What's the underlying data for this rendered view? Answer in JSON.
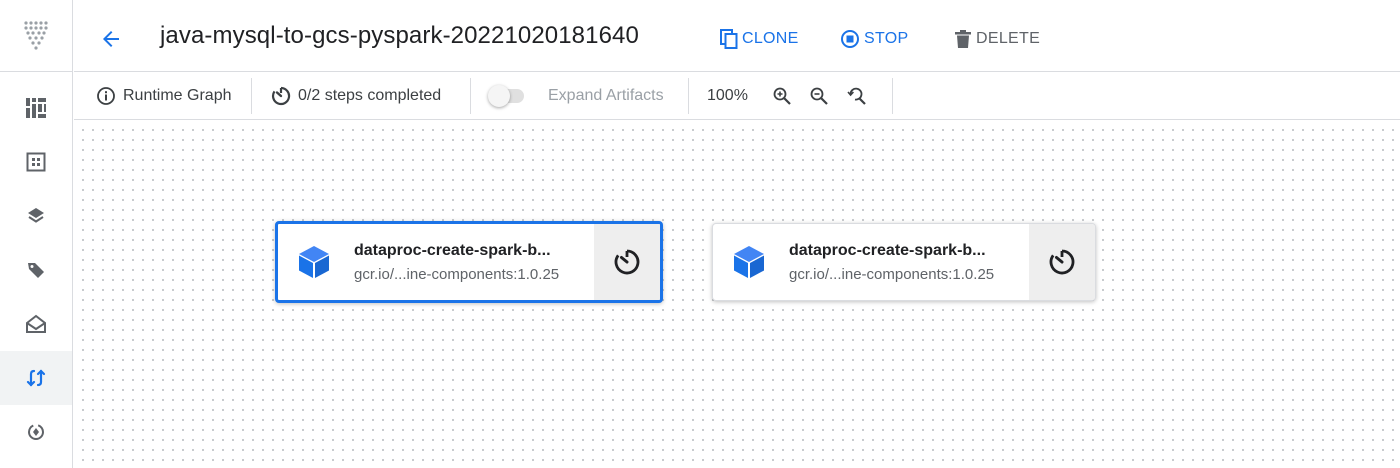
{
  "header": {
    "run_title": "java-mysql-to-gcs-pyspark-20221020181640",
    "clone_label": "CLONE",
    "stop_label": "STOP",
    "delete_label": "DELETE"
  },
  "toolbar": {
    "runtime_graph_label": "Runtime Graph",
    "steps_status": "0/2 steps completed",
    "expand_artifacts_label": "Expand Artifacts",
    "expand_artifacts_on": false,
    "zoom_level": "100%"
  },
  "sidebar": {
    "items": [
      {
        "icon": "dashboard-icon"
      },
      {
        "icon": "grid-icon"
      },
      {
        "icon": "layers-icon"
      },
      {
        "icon": "tag-icon"
      },
      {
        "icon": "experiment-icon"
      },
      {
        "icon": "runs-icon",
        "active": true
      },
      {
        "icon": "recurring-icon"
      }
    ]
  },
  "graph": {
    "nodes": [
      {
        "name": "dataproc-create-spark-b...",
        "image": "gcr.io/...ine-components:1.0.25",
        "status": "running",
        "selected": true
      },
      {
        "name": "dataproc-create-spark-b...",
        "image": "gcr.io/...ine-components:1.0.25",
        "status": "running",
        "selected": false
      }
    ]
  },
  "colors": {
    "accent": "#1a73e8",
    "border": "#dadce0",
    "text_muted": "#5f6368"
  }
}
